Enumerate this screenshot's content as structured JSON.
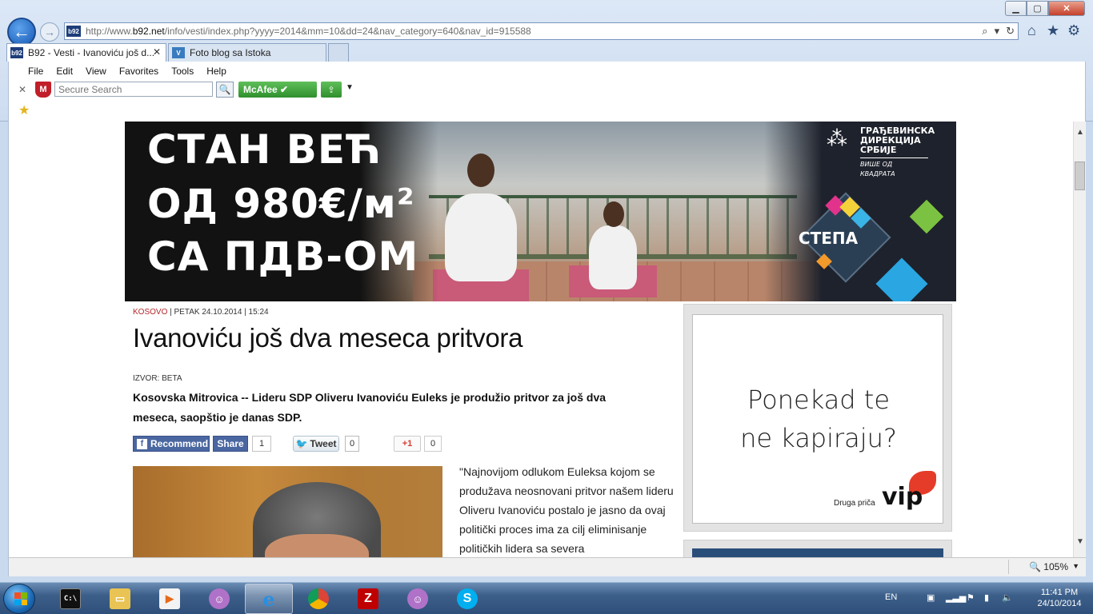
{
  "browser": {
    "url_prefix": "http://www.",
    "url_domain": "b92.net",
    "url_rest": "/info/vesti/index.php?yyyy=2014&mm=10&dd=24&nav_category=640&nav_id=915588",
    "favicon_text": "b92",
    "tabs": [
      {
        "label": "B92 - Vesti - Ivanoviću još d...",
        "icon": "b92"
      },
      {
        "label": "Foto blog sa Istoka",
        "icon": "V"
      }
    ],
    "menu": [
      "File",
      "Edit",
      "View",
      "Favorites",
      "Tools",
      "Help"
    ],
    "search_placeholder": "Secure Search",
    "mcafee_label": "McAfee",
    "mcafee_shield": "M",
    "zoom": "105%"
  },
  "banner": {
    "line1": "СТАН ВЕЋ",
    "line2": "ОД 980€/м²",
    "line3": "СА ПДВ-ОМ",
    "logo_line1": "ГРАЂЕВИНСКА",
    "logo_line2": "ДИРЕКЦИЈА",
    "logo_line3": "СРБИЈЕ",
    "logo_tagline": "ВИШЕ ОД КВАДРАТА",
    "project": "СТЕПА"
  },
  "article": {
    "category": "KOSOVO",
    "meta": " | PETAK 24.10.2014 | 15:24",
    "title": "Ivanoviću još dva meseca pritvora",
    "source": "IZVOR: BETA",
    "lead": "Kosovska Mitrovica -- Lideru SDP Oliveru Ivanoviću Euleks je produžio pritvor za još dva meseca, saopštio je danas SDP.",
    "body": "\"Najnovijom odlukom Euleksa kojom se produžava neosnovani pritvor našem lideru Oliveru Ivanoviću postalo je jasno da ovaj politički proces ima za cilj eliminisanje političkih lidera sa severa"
  },
  "social": {
    "recommend_label": "Recommend",
    "share_label": "Share",
    "fb_count": "1",
    "tweet_label": "Tweet",
    "tweet_count": "0",
    "gplus_label": "+1",
    "gplus_count": "0"
  },
  "sidebar_ad": {
    "line1": "Ponekad te",
    "line2": "ne kapiraju?",
    "brand_text": "Druga priča",
    "logo": "vip"
  },
  "taskbar": {
    "lang": "EN",
    "time": "11:41 PM",
    "date": "24/10/2014"
  }
}
